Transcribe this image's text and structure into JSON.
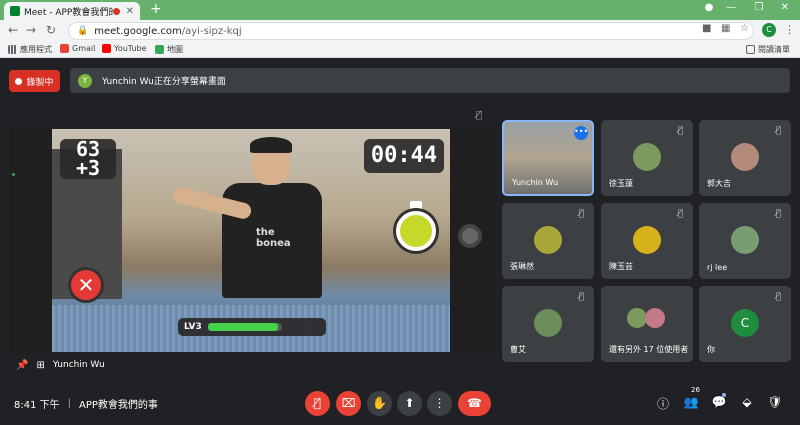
{
  "browser": {
    "tab_title": "Meet - APP教會我們的事",
    "new_tab_glyph": "+",
    "url_host": "meet.google.com",
    "url_path": "/ayi-sipz-kqj",
    "profile_initial": "C",
    "bookmarks": [
      "應用程式",
      "Gmail",
      "YouTube",
      "地圖"
    ],
    "reading_list": "閱讀清單"
  },
  "meet": {
    "recording_label": "錄製中",
    "presenting_avatar_initial": "Y",
    "presenting_text": "Yunchin Wu正在分享螢幕畫面",
    "presenter_name": "Yunchin Wu",
    "game": {
      "score": "63",
      "score_bonus": "+3",
      "timer": "00:44",
      "level_label": "LV3",
      "level_progress": 0.95,
      "shirt_text": "the\nbonea"
    },
    "tiles": [
      {
        "name": "Yunchin Wu",
        "video": true,
        "avatar_color": "#9aa0a6"
      },
      {
        "name": "徐玉蓮",
        "avatar_color": "#7c9a5e"
      },
      {
        "name": "郭大吉",
        "avatar_color": "#b48a7a"
      },
      {
        "name": "張琳然",
        "avatar_color": "#a8a83a"
      },
      {
        "name": "陳玉芸",
        "avatar_color": "#d6b11a"
      },
      {
        "name": "rj lee",
        "avatar_color": "#7a9c72"
      },
      {
        "name": "曹艾",
        "avatar_color": "#6b8e5a"
      },
      {
        "name": "還有另外 17 位使用者",
        "avatar_color": "#c27a86"
      },
      {
        "name": "你",
        "avatar_initial": "C",
        "avatar_color": "#1e8e3e"
      }
    ],
    "bottom": {
      "time": "8:41 下午",
      "separator": "|",
      "meeting_title": "APP教會我們的事",
      "people_count": "26"
    }
  },
  "colors": {
    "titlebar": "#66b16c",
    "meet_bg": "#202124",
    "tile_bg": "#3c4043",
    "danger": "#ea4335",
    "accent": "#8ab4f8"
  },
  "icons": [
    "mic-off-icon",
    "camera-off-icon",
    "raise-hand-icon",
    "present-icon",
    "more-icon",
    "hangup-icon",
    "info-icon",
    "people-icon",
    "chat-icon",
    "activities-icon",
    "host-controls-icon",
    "pin-icon"
  ]
}
